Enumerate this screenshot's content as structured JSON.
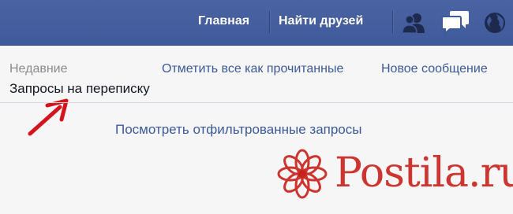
{
  "topbar": {
    "nav_home": "Главная",
    "nav_find_friends": "Найти друзей",
    "icons": [
      "friends-icon",
      "messages-icon",
      "globe-icon"
    ]
  },
  "panel": {
    "tab_recent": "Недавние",
    "tab_requests": "Запросы на переписку",
    "mark_all_read": "Отметить все как прочитанные",
    "new_message": "Новое сообщение",
    "view_filtered": "Посмотреть отфильтрованные запросы"
  },
  "watermark": {
    "text": "Postila.ru",
    "color": "#c8201a"
  },
  "colors": {
    "topbar": "#3f5a9a",
    "link": "#3b5998",
    "arrow": "#d4141d"
  }
}
